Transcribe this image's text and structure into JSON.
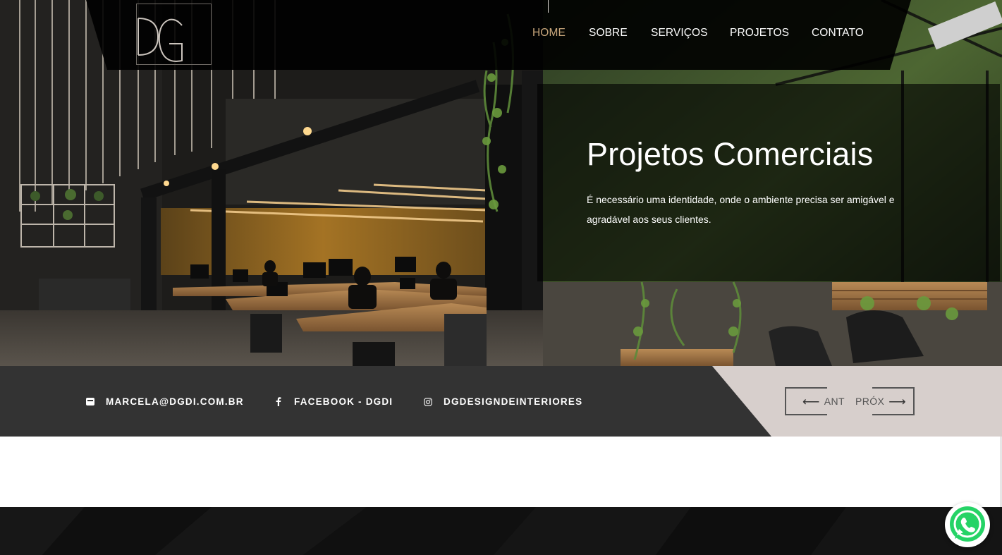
{
  "brand": {
    "logo_text": "DG"
  },
  "nav": {
    "items": [
      {
        "label": "HOME",
        "active": true
      },
      {
        "label": "SOBRE",
        "active": false
      },
      {
        "label": "SERVIÇOS",
        "active": false
      },
      {
        "label": "PROJETOS",
        "active": false
      },
      {
        "label": "CONTATO",
        "active": false
      }
    ]
  },
  "slide": {
    "title": "Projetos Comerciais",
    "text": "É necessário uma identidade, onde o ambiente precisa ser amigável e agradável aos seus clientes."
  },
  "contacts": [
    {
      "icon": "envelope-icon",
      "label": "MARCELA@DGDI.COM.BR"
    },
    {
      "icon": "facebook-icon",
      "label": "FACEBOOK - DGDI"
    },
    {
      "icon": "instagram-icon",
      "label": "DGDESIGNDEINTERIORES"
    }
  ],
  "slider_controls": {
    "prev_label": "ANT",
    "next_label": "PRÓX"
  },
  "colors": {
    "accent": "#c9a77c",
    "strip_dark": "#333333",
    "strip_light": "#d7cfcc",
    "whatsapp": "#25d366"
  }
}
